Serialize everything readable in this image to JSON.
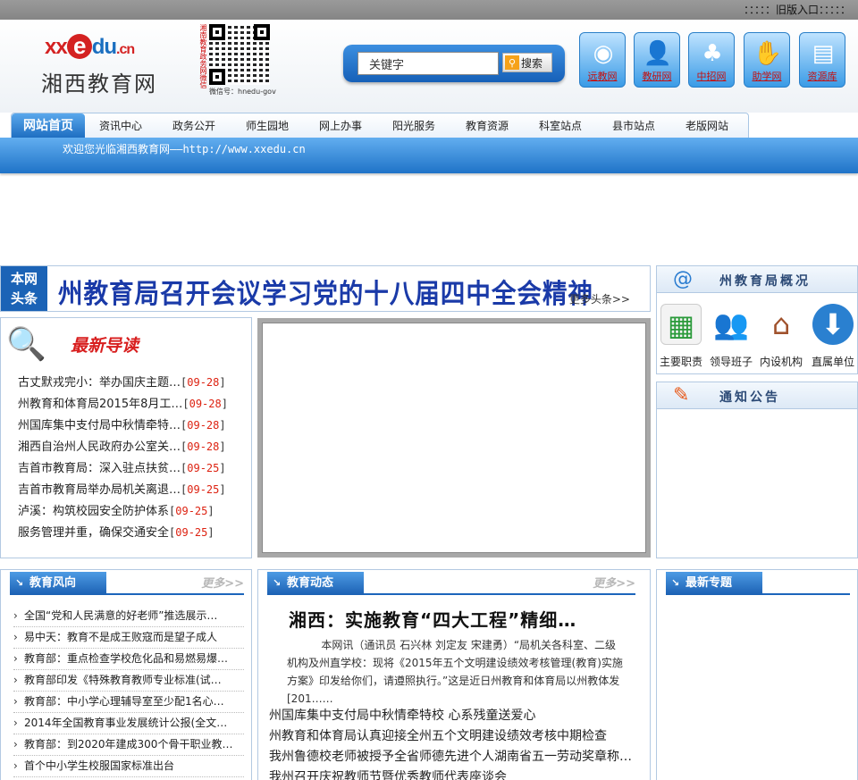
{
  "topbar": {
    "old_version": "：：：：：旧版入口：：：：："
  },
  "logo": {
    "en_xx": "xx",
    "en_e": "e",
    "en_du": "du",
    "en_cn": ".cn",
    "zh": "湘西教育网"
  },
  "qr": {
    "side_text": "湘南教育政务网微信",
    "id": "微信号：hnedu-gov"
  },
  "search": {
    "placeholder": "关键字",
    "value": "关键字",
    "button": "搜索"
  },
  "quick_links": [
    {
      "label": "远教网",
      "icon": "disc-icon"
    },
    {
      "label": "教研网",
      "icon": "person-icon"
    },
    {
      "label": "中招网",
      "icon": "tree-icon"
    },
    {
      "label": "助学网",
      "icon": "helping-hand-icon"
    },
    {
      "label": "资源库",
      "icon": "cabinet-icon"
    }
  ],
  "nav": [
    "网站首页",
    "资讯中心",
    "政务公开",
    "师生园地",
    "网上办事",
    "阳光服务",
    "教育资源",
    "科室站点",
    "县市站点",
    "老版网站"
  ],
  "welcome": "欢迎您光临湘西教育网——http://www.xxedu.cn",
  "headline": {
    "tag1": "本网",
    "tag2": "头条",
    "title": "州教育局召开会议学习党的十八届四中全会精神",
    "more": "更多头条>>"
  },
  "bureau": {
    "title": "州教育局概况",
    "items": [
      "主要职责",
      "领导班子",
      "内设机构",
      "直属单位"
    ]
  },
  "notice": {
    "title": "通知公告"
  },
  "latest": {
    "title": "最新导读",
    "items": [
      {
        "text": "古丈默戎完小：举办国庆主题…",
        "date": "09-28"
      },
      {
        "text": "州教育和体育局2015年8月工…",
        "date": "09-28"
      },
      {
        "text": "州国库集中支付局中秋情牵特…",
        "date": "09-28"
      },
      {
        "text": "湘西自治州人民政府办公室关…",
        "date": "09-28"
      },
      {
        "text": "吉首市教育局：深入驻点扶贫…",
        "date": "09-25"
      },
      {
        "text": "吉首市教育局举办局机关离退…",
        "date": "09-25"
      },
      {
        "text": "泸溪：构筑校园安全防护体系",
        "date": "09-25"
      },
      {
        "text": "服务管理并重，确保交通安全",
        "date": "09-25"
      }
    ]
  },
  "edu_trend": {
    "title": "教育风向",
    "more": "更多>>",
    "items": [
      "全国“党和人民满意的好老师”推选展示…",
      "易中天：教育不是成王败寇而是望子成人",
      "教育部：重点检查学校危化品和易燃易爆…",
      "教育部印发《特殊教育教师专业标准(试…",
      "教育部：中小学心理辅导室至少配1名心…",
      "2014年全国教育事业发展统计公报(全文…",
      "教育部：到2020年建成300个骨干职业教…",
      "首个中小学生校服国家标准出台"
    ]
  },
  "edu_news": {
    "title": "教育动态",
    "more": "更多>>",
    "lead_title": "湘西：实施教育“四大工程”精细…",
    "lead_summary": "本网讯（通讯员 石兴林 刘定友 宋建勇）“局机关各科室、二级机构及州直学校：现将《2015年五个文明建设绩效考核管理(教育)实施方案》印发给你们，请遵照执行。”这是近日州教育和体育局以州教体发[201……",
    "items": [
      "州国库集中支付局中秋情牵特校 心系残童送爱心",
      "州教育和体育局认真迎接全州五个文明建设绩效考核中期检查",
      "我州鲁德校老师被授予全省师德先进个人湖南省五一劳动奖章称…",
      "我州召开庆祝教师节暨优秀教师代表座谈会"
    ]
  },
  "special": {
    "title": "最新专题"
  }
}
